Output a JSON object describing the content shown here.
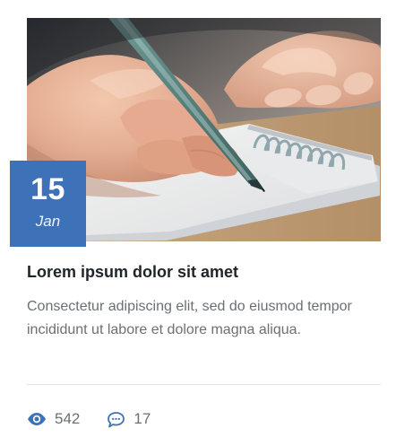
{
  "post": {
    "image_alt": "hand writing in spiral notebook with pen",
    "date": {
      "day": "15",
      "month": "Jan"
    },
    "title": "Lorem ipsum dolor sit amet",
    "excerpt": "Consectetur adipiscing elit, sed do eiusmod tempor incididunt ut labore et dolore magna aliqua.",
    "stats": {
      "views": "542",
      "comments": "17"
    }
  },
  "icons": {
    "views": "eye-icon",
    "comments": "comment-icon"
  },
  "colors": {
    "accent": "#3d72b8",
    "title": "#1f2428",
    "body_text": "#6b7075",
    "divider": "#e3e5e8"
  }
}
